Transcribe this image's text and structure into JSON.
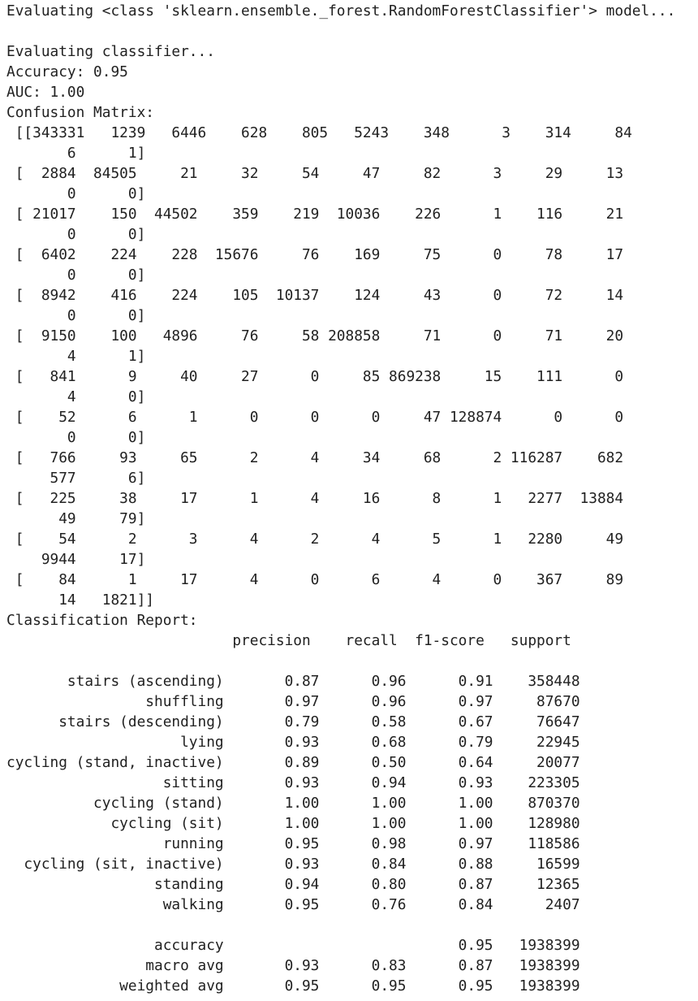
{
  "output": {
    "lines": [
      "Evaluating <class 'sklearn.ensemble._forest.RandomForestClassifier'> model...",
      "",
      "Evaluating classifier...",
      "Accuracy: 0.95",
      "AUC: 1.00",
      "Confusion Matrix:",
      " [[343331   1239   6446    628    805   5243    348      3    314     84",
      "       6      1]",
      " [  2884  84505     21     32     54     47     82      3     29     13",
      "       0      0]",
      " [ 21017    150  44502    359    219  10036    226      1    116     21",
      "       0      0]",
      " [  6402    224    228  15676     76    169     75      0     78     17",
      "       0      0]",
      " [  8942    416    224    105  10137    124     43      0     72     14",
      "       0      0]",
      " [  9150    100   4896     76     58 208858     71      0     71     20",
      "       4      1]",
      " [   841      9     40     27      0     85 869238     15    111      0",
      "       4      0]",
      " [    52      6      1      0      0      0     47 128874      0      0",
      "       0      0]",
      " [   766     93     65      2      4     34     68      2 116287    682",
      "     577      6]",
      " [   225     38     17      1      4     16      8      1   2277  13884",
      "      49     79]",
      " [    54      2      3      4      2      4      5      1   2280     49",
      "    9944     17]",
      " [    84      1     17      4      0      6      4      0    367     89",
      "      14   1821]]",
      "Classification Report:",
      "                          precision    recall  f1-score   support",
      "",
      "       stairs (ascending)       0.87      0.96      0.91    358448",
      "                shuffling       0.97      0.96      0.97     87670",
      "      stairs (descending)       0.79      0.58      0.67     76647",
      "                    lying       0.93      0.68      0.79     22945",
      "cycling (stand, inactive)       0.89      0.50      0.64     20077",
      "                  sitting       0.93      0.94      0.93    223305",
      "          cycling (stand)       1.00      1.00      1.00    870370",
      "            cycling (sit)       1.00      1.00      1.00    128980",
      "                  running       0.95      0.98      0.97    118586",
      "  cycling (sit, inactive)       0.93      0.84      0.88     16599",
      "                 standing       0.94      0.80      0.87     12365",
      "                  walking       0.95      0.76      0.84      2407",
      "",
      "                 accuracy                           0.95   1938399",
      "                macro avg       0.93      0.83      0.87   1938399",
      "             weighted avg       0.95      0.95      0.95   1938399"
    ]
  }
}
